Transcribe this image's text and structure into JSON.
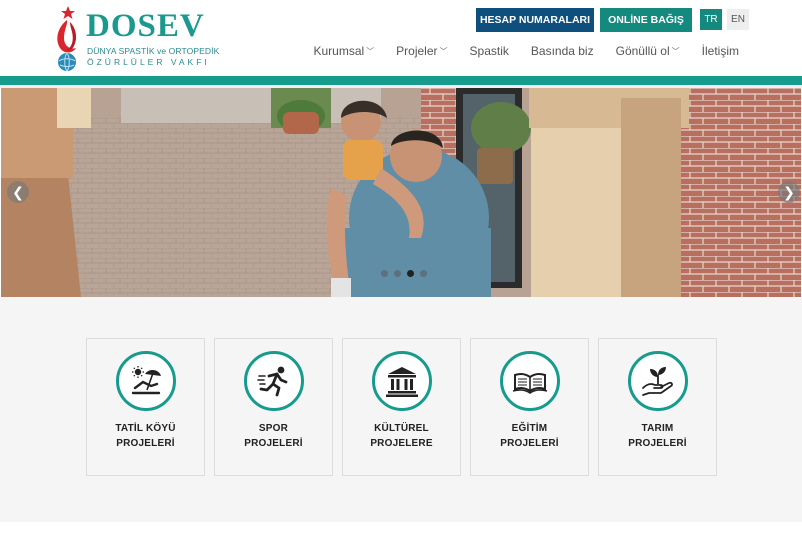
{
  "logo": {
    "title": "DOSEV",
    "subtitle_line1": "DÜNYA SPASTİK ve ORTOPEDİK",
    "subtitle_line2": "ÖZÜRLÜLER VAKFI"
  },
  "top_buttons": {
    "hesap": "HESAP NUMARALARI",
    "bagis": "ONLİNE BAĞIŞ"
  },
  "languages": [
    "TR",
    "EN"
  ],
  "nav": [
    {
      "label": "Kurumsal",
      "dropdown": true
    },
    {
      "label": "Projeler",
      "dropdown": true
    },
    {
      "label": "Spastik",
      "dropdown": false
    },
    {
      "label": "Basında biz",
      "dropdown": false
    },
    {
      "label": "Gönüllü ol",
      "dropdown": true
    },
    {
      "label": "İletişim",
      "dropdown": false
    }
  ],
  "slider": {
    "prev_glyph": "❮",
    "next_glyph": "❯",
    "slide_count": 4,
    "active_index": 2
  },
  "projects": [
    {
      "line1": "TATİL KÖYÜ",
      "line2": "PROJELERİ",
      "icon": "beach-umbrella-icon"
    },
    {
      "line1": "SPOR",
      "line2": "PROJELERİ",
      "icon": "running-person-icon"
    },
    {
      "line1": "KÜLTÜREL",
      "line2": "PROJELERE",
      "icon": "museum-building-icon"
    },
    {
      "line1": "EĞİTİM",
      "line2": "PROJELERİ",
      "icon": "open-book-icon"
    },
    {
      "line1": "TARIM",
      "line2": "PROJELERİ",
      "icon": "plant-in-hand-icon"
    }
  ],
  "colors": {
    "teal": "#169b8c",
    "navy": "#0e4f7d"
  }
}
